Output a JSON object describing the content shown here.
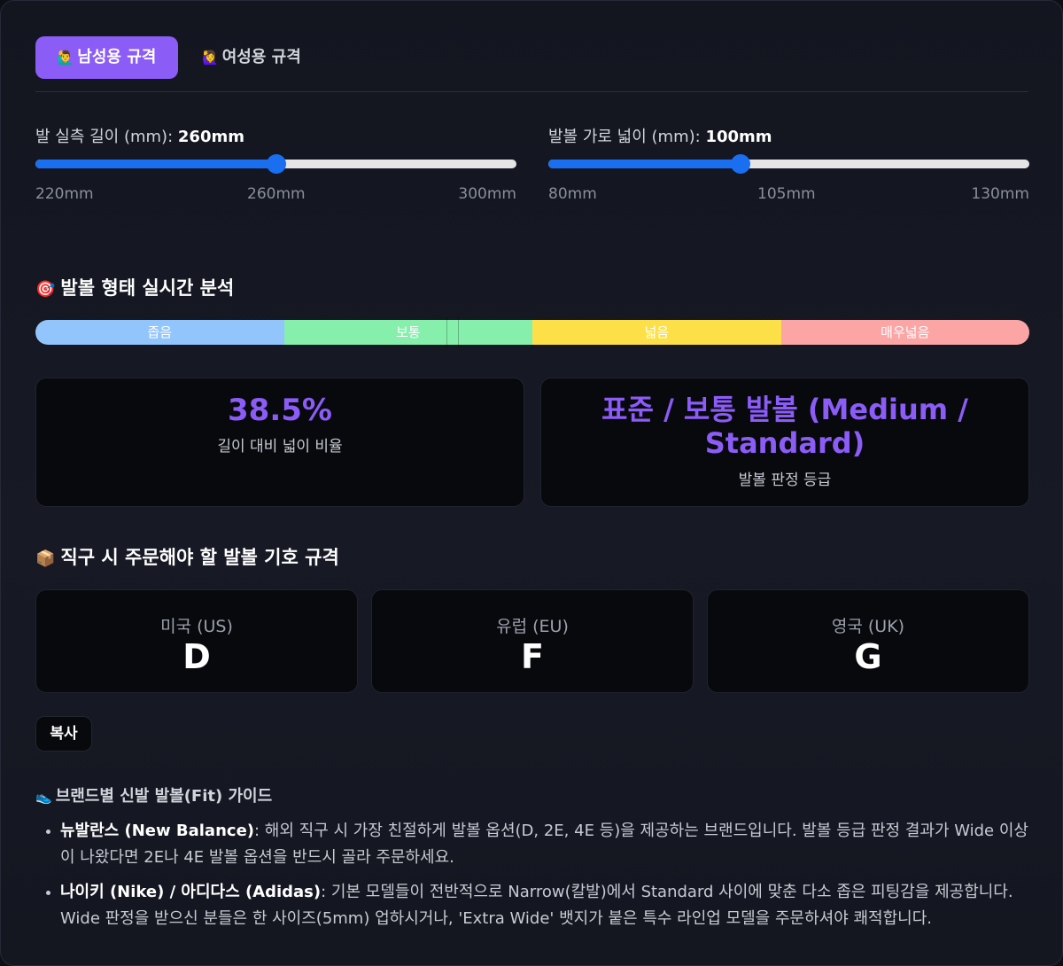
{
  "tabs": [
    {
      "emoji": "🙋‍♂️",
      "label": "남성용 규격",
      "active": true
    },
    {
      "emoji": "🙋‍♀️",
      "label": "여성용 규격",
      "active": false
    }
  ],
  "length_slider": {
    "label": "발 실측 길이 (mm):",
    "value_text": "260mm",
    "value": 260,
    "min": 220,
    "max": 300,
    "ticks": [
      "220mm",
      "260mm",
      "300mm"
    ]
  },
  "width_slider": {
    "label": "발볼 가로 넓이 (mm):",
    "value_text": "100mm",
    "value": 100,
    "min": 80,
    "max": 130,
    "ticks": [
      "80mm",
      "105mm",
      "130mm"
    ]
  },
  "analysis": {
    "emoji": "🎯",
    "title": "발볼 형태 실시간 분석",
    "bands": [
      {
        "label": "좁음",
        "color": "#93c5fd"
      },
      {
        "label": "보통",
        "color": "#86efac"
      },
      {
        "label": "넓음",
        "color": "#fde047"
      },
      {
        "label": "매우넓음",
        "color": "#fca5a5"
      }
    ],
    "ratio_value": "38.5%",
    "ratio_caption": "길이 대비 넓이 비율",
    "grade_value": "표준 / 보통 발볼 (Medium / Standard)",
    "grade_caption": "발볼 판정 등급"
  },
  "order": {
    "emoji": "📦",
    "title": "직구 시 주문해야 할 발볼 기호 규격",
    "codes": [
      {
        "region": "미국 (US)",
        "code": "D"
      },
      {
        "region": "유럽 (EU)",
        "code": "F"
      },
      {
        "region": "영국 (UK)",
        "code": "G"
      }
    ],
    "copy_label": "복사"
  },
  "guide": {
    "emoji": "👟",
    "title": "브랜드별 신발 발볼(Fit) 가이드",
    "items": [
      {
        "brand": "뉴발란스 (New Balance)",
        "text": ": 해외 직구 시 가장 친절하게 발볼 옵션(D, 2E, 4E 등)을 제공하는 브랜드입니다. 발볼 등급 판정 결과가 Wide 이상이 나왔다면 2E나 4E 발볼 옵션을 반드시 골라 주문하세요."
      },
      {
        "brand": "나이키 (Nike) / 아디다스 (Adidas)",
        "text": ": 기본 모델들이 전반적으로 Narrow(칼발)에서 Standard 사이에 맞춘 다소 좁은 피팅감을 제공합니다. Wide 판정을 받으신 분들은 한 사이즈(5mm) 업하시거나, 'Extra Wide' 뱃지가 붙은 특수 라인업 모델을 주문하셔야 쾌적합니다."
      }
    ]
  },
  "colors": {
    "accent": "#8b5cf6",
    "slider": "#1a6ff0"
  }
}
